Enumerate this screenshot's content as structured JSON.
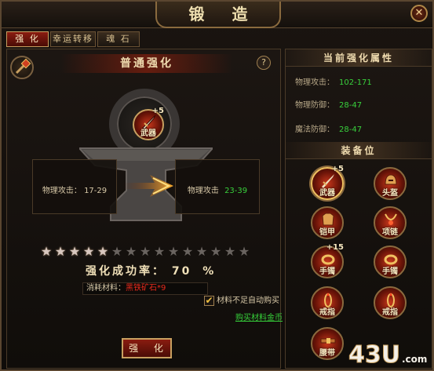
{
  "window": {
    "title": "锻 造",
    "close_glyph": "✕"
  },
  "tabs": [
    "强 化",
    "幸运转移",
    "魂 石"
  ],
  "enhance": {
    "header": "普通强化",
    "help": "?",
    "item": {
      "name": "武器",
      "plus": "+5",
      "icon": "sword-icon"
    },
    "current_stat": {
      "label": "物理攻击：",
      "value": "17-29"
    },
    "next_stat": {
      "label": "物理攻击",
      "value": "23-39"
    },
    "stars": {
      "total": 15,
      "filled": 5
    },
    "success_rate": {
      "label": "强化成功率：",
      "value": "70",
      "unit": "%"
    },
    "cost": {
      "label": "消耗材料：",
      "material": "黑铁矿石*9"
    },
    "button": "强 化",
    "auto_buy_label": "材料不足自动购买",
    "auto_buy_checked": true,
    "buy_link": "购买材料金币"
  },
  "current_attrs": {
    "header": "当前强化属性",
    "rows": [
      {
        "label": "物理攻击：",
        "value": "102-171"
      },
      {
        "label": "物理防御：",
        "value": "28-47"
      },
      {
        "label": "魔法防御：",
        "value": "28-47"
      }
    ]
  },
  "equipment": {
    "header": "装备位",
    "slots": [
      {
        "name": "武器",
        "plus": "+5",
        "icon": "sword-icon",
        "selected": true
      },
      {
        "name": "头盔",
        "plus": "",
        "icon": "helmet-icon",
        "selected": false
      },
      {
        "name": "铠甲",
        "plus": "",
        "icon": "armor-icon",
        "selected": false
      },
      {
        "name": "项链",
        "plus": "",
        "icon": "necklace-icon",
        "selected": false
      },
      {
        "name": "手镯",
        "plus": "+15",
        "icon": "bracelet-icon",
        "selected": false
      },
      {
        "name": "手镯",
        "plus": "",
        "icon": "bracelet-icon",
        "selected": false
      },
      {
        "name": "戒指",
        "plus": "",
        "icon": "ring-icon",
        "selected": false
      },
      {
        "name": "戒指",
        "plus": "",
        "icon": "ring-icon",
        "selected": false
      },
      {
        "name": "腰带",
        "plus": "",
        "icon": "belt-icon",
        "selected": false
      }
    ]
  },
  "watermark": "43U.com",
  "colors": {
    "accent_red": "#8a1c10",
    "gold_border": "#c8a060",
    "stat_green": "#38d03c",
    "material_red": "#e82a1c"
  }
}
